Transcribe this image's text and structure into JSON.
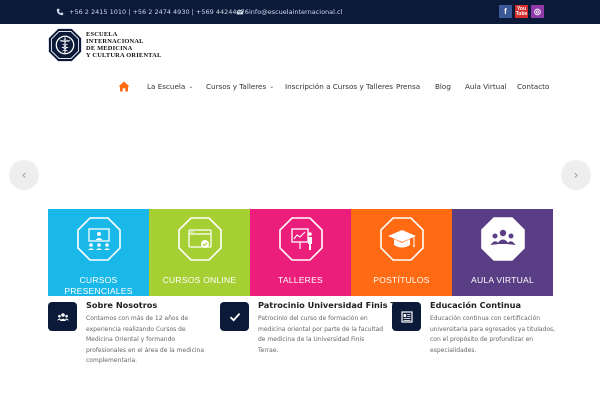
{
  "topbar": {
    "phone": "+56 2 2415 1010 | +56 2 2474 4930 | +569 44244476",
    "email": "info@escuelainternacional.cl",
    "socials": {
      "facebook": "f",
      "youtube_top": "You",
      "youtube_bottom": "Tube",
      "instagram": "◎"
    }
  },
  "logo": {
    "line1": "ESCUELA",
    "line2": "INTERNACIONAL",
    "line3": "DE MEDICINA",
    "line4": "Y CULTURA ORIENTAL"
  },
  "nav": {
    "items": [
      {
        "label": "La Escuela",
        "has_caret": true
      },
      {
        "label": "Cursos y Talleres",
        "has_caret": true
      },
      {
        "label": "Inscripción a Cursos y Talleres"
      },
      {
        "label": "Prensa"
      },
      {
        "label": "Blog"
      },
      {
        "label": "Aula Virtual"
      },
      {
        "label": "Contacto"
      }
    ],
    "caret": "⌄"
  },
  "slider": {
    "prev": "‹",
    "next": "›",
    "tiles": [
      {
        "label": "CURSOS PRESENCIALES",
        "color": "#1ab8e8",
        "icon": "classroom-icon"
      },
      {
        "label": "CURSOS ONLINE",
        "color": "#a6cf33",
        "icon": "browser-check-icon"
      },
      {
        "label": "TALLERES",
        "color": "#ec1e7b",
        "icon": "presentation-icon"
      },
      {
        "label": "POSTÍTULOS",
        "color": "#ff6a13",
        "icon": "graduation-cap-icon"
      },
      {
        "label": "AULA VIRTUAL",
        "color": "#5a3e85",
        "icon": "group-icon"
      }
    ]
  },
  "features": [
    {
      "title": "Sobre Nosotros",
      "text": "Contamos con más de 12 años de experiencia realizando Cursos de Medicina Oriental y formando profesionales en el área de la medicina complementaria.",
      "icon": "users-icon"
    },
    {
      "title": "Patrocinio Universidad Finis Terrae",
      "text": "Patrocinio del curso de formación en medicina oriental por parte de la facultad de medicina de la Universidad Finis Terrae.",
      "icon": "checkmark-icon"
    },
    {
      "title": "Educación Continua",
      "text": "Educación continua con certificación universitaria para egresados ya titulados, con el propósito de profundizar en especialidades.",
      "icon": "document-icon"
    }
  ],
  "colors": {
    "navy": "#0c1a3a",
    "home": "#ff6a13"
  }
}
